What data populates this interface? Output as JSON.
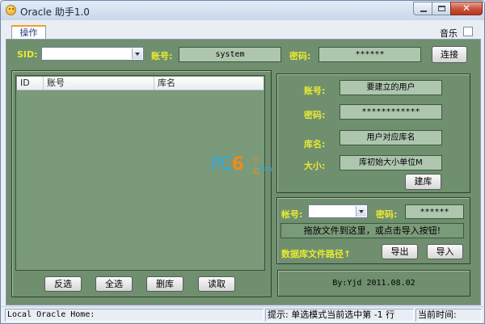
{
  "window": {
    "title": "Oracle 助手1.0"
  },
  "tabs": [
    {
      "label": "操作"
    }
  ],
  "music": {
    "label": "音乐",
    "checked": false
  },
  "connection": {
    "sid_label": "SID:",
    "sid_value": "",
    "account_label": "账号:",
    "account_value": "system",
    "password_label": "密码:",
    "password_value": "******",
    "connect_button": "连接"
  },
  "db_list": {
    "columns": [
      "ID",
      "账号",
      "库名"
    ],
    "rows": []
  },
  "create_user": {
    "account_label": "账号:",
    "account_value": "要建立的用户",
    "password_label": "密码:",
    "password_value": "************",
    "dbname_label": "库名:",
    "dbname_value": "用户对应库名",
    "size_label": "大小:",
    "size_value": "库初始大小单位M",
    "create_button": "建库"
  },
  "import": {
    "account_label": "帐号:",
    "account_value": "",
    "password_label": "密码:",
    "password_value": "******",
    "drop_hint": "拖放文件到这里，或点击导入按钮!",
    "path_label": "数据库文件路径↑",
    "export_button": "导出",
    "import_button": "导入"
  },
  "actions": {
    "invert_button": "反选",
    "select_all_button": "全选",
    "delete_button": "删库",
    "read_button": "读取"
  },
  "credit": "By:Yjd 2011.08.02",
  "watermark": {
    "main_pc": "PC",
    "main_6": "6",
    "sub_top": "下载",
    "sub_bottom": ".com"
  },
  "status": {
    "oracle_home": "Local Oracle Home:",
    "hint": "提示: 单选模式当前选中第 -1 行",
    "time": "当前时间:"
  }
}
